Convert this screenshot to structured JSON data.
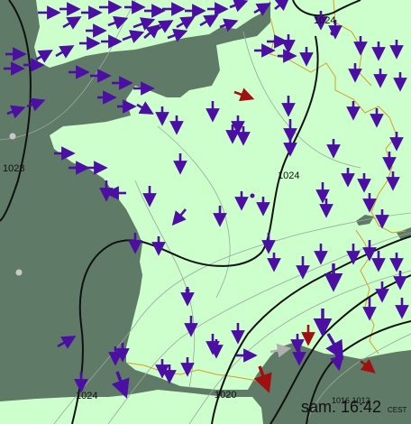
{
  "map": {
    "timestamp": "sam. 16:42",
    "timezone": "CEST",
    "isobar_labels": {
      "north_east": "1024",
      "center": "1024",
      "west": "1028",
      "south_west": "1024",
      "south": "1020",
      "south_east": "1016 1012"
    },
    "colors": {
      "sea": "#5f7a66",
      "land": "#ccffcc",
      "wind_arrow": "#4b0fa3",
      "strong_wind_arrow": "#a01010",
      "calm_arrow": "#b0b0b0",
      "isobar": "#111111",
      "border": "#d4a020"
    },
    "icons": {
      "wind": "wind-arrow-icon",
      "station": "station-dot-icon"
    }
  }
}
